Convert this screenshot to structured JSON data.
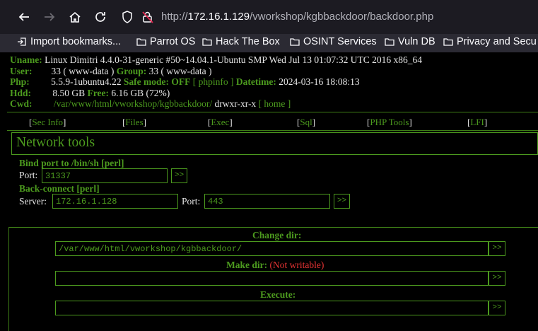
{
  "browser": {
    "url_prefix": "http://",
    "url_host": "172.16.1.129",
    "url_path": "/vworkshop/kgbbackdoor/backdoor.php",
    "bookmarks": [
      {
        "label": "Import bookmarks...",
        "icon": "import-icon"
      },
      {
        "label": "Parrot OS",
        "icon": "folder-icon"
      },
      {
        "label": "Hack The Box",
        "icon": "folder-icon"
      },
      {
        "label": "OSINT Services",
        "icon": "folder-icon"
      },
      {
        "label": "Vuln DB",
        "icon": "folder-icon"
      },
      {
        "label": "Privacy and Secu",
        "icon": "folder-icon"
      }
    ]
  },
  "sysinfo": {
    "uname_label": "Uname:",
    "uname_value": "Linux Dimitri 4.4.0-31-generic #50~14.04.1-Ubuntu SMP Wed Jul 13 01:07:32 UTC 2016 x86_64",
    "user_label": "User:",
    "user_value": "33 ( www-data )",
    "group_label": "Group:",
    "group_value": "33 ( www-data )",
    "php_label": "Php:",
    "php_value": "5.5.9-1ubuntu4.22",
    "safe_mode_label": "Safe mode:",
    "safe_mode_value": "OFF",
    "phpinfo_link": "[ phpinfo ]",
    "datetime_label": "Datetime:",
    "datetime_value": "2024-03-16 18:08:13",
    "hdd_label": "Hdd:",
    "hdd_value": "8.50 GB",
    "free_label": "Free:",
    "free_value": "6.16 GB (72%)",
    "cwd_label": "Cwd:",
    "cwd_path": "/var/www/html/vworkshop/kgbbackdoor/",
    "cwd_perms": "drwxr-xr-x",
    "home_link": "[ home ]"
  },
  "menu": [
    "Sec Info",
    "Files",
    "Exec",
    "Sql",
    "PHP Tools",
    "LFI"
  ],
  "network": {
    "title": "Network tools",
    "bind_heading": "Bind port to /bin/sh [perl]",
    "port_label": "Port:",
    "bind_port": "31337",
    "back_heading": "Back-connect [perl]",
    "server_label": "Server:",
    "server_value": "172.16.1.128",
    "bc_port_label": "Port:",
    "bc_port_value": "443",
    "go_label": ">>"
  },
  "bottom": {
    "change_dir_label": "Change dir:",
    "change_dir_value": "/var/www/html/vworkshop/kgbbackdoor/",
    "make_dir_label": "Make dir:",
    "make_dir_note": "(Not writable)",
    "make_dir_value": "",
    "execute_label": "Execute:",
    "execute_value": "",
    "go_label": ">>"
  },
  "colors": {
    "accent_green": "#4c9a1e",
    "warning_red": "#e53333"
  }
}
